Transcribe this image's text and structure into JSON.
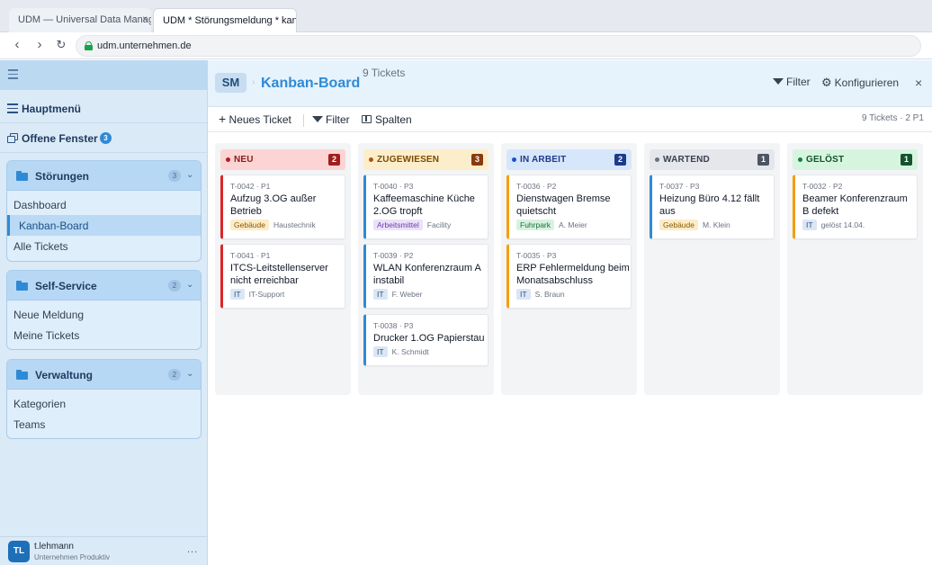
{
  "browser": {
    "tabs": [
      {
        "label": "UDM — Universal Data Manag...",
        "active": false
      },
      {
        "label": "UDM * Störungsmeldung * kanb...",
        "active": true
      }
    ],
    "url": "udm.unternehmen.de"
  },
  "sidebar": {
    "main_menu": "Hauptmenü",
    "open_windows": "Offene Fenster",
    "open_windows_count": "3",
    "groups": [
      {
        "label": "Störungen",
        "count": "3",
        "items": [
          "Dashboard",
          "Kanban-Board",
          "Alle Tickets"
        ],
        "active_item": 1
      },
      {
        "label": "Self-Service",
        "count": "2",
        "items": [
          "Neue Meldung",
          "Meine Tickets"
        ]
      },
      {
        "label": "Verwaltung",
        "count": "2",
        "items": [
          "Kategorien",
          "Teams"
        ]
      }
    ],
    "user": {
      "initials": "TL",
      "name": "t.lehmann",
      "org": "Unternehmen Produktiv",
      "more": "..."
    }
  },
  "header": {
    "module": "SM",
    "title": "Kanban-Board",
    "ticket_count": "9 Tickets",
    "filter": "Filter",
    "configure": "Konfigurieren",
    "close": "×"
  },
  "toolbar": {
    "new_ticket": "Neues Ticket",
    "filter": "Filter",
    "columns": "Spalten",
    "summary": "9 Tickets · 2 P1"
  },
  "colors": {
    "accent": "#2f8ad6",
    "sidebar_bg": "#dbeaf7"
  },
  "columns": [
    {
      "title": "NEU",
      "count": "2",
      "head_bg": "#fcd4d4",
      "title_color": "#8b1a1a",
      "dot": "#b91c1c",
      "badge_bg": "#a11d1d",
      "card_border": "#dc2626",
      "cards": [
        {
          "id": "T-0042 · P1",
          "title": "Aufzug 3.OG außer Betrieb",
          "tag": "Gebäude",
          "tag_bg": "#fdecc8",
          "tag_fg": "#8a5a00",
          "meta": "Haustechnik"
        },
        {
          "id": "T-0041 · P1",
          "title": "ITCS-Leitstellenserver nicht erreichbar",
          "tag": "IT",
          "tag_bg": "#dbe6f5",
          "tag_fg": "#2c4f7c",
          "meta": "IT-Support"
        }
      ]
    },
    {
      "title": "ZUGEWIESEN",
      "count": "3",
      "head_bg": "#fdeecb",
      "title_color": "#7a4a00",
      "dot": "#b45309",
      "badge_bg": "#8a3a10",
      "card_border": "#2f8ad6",
      "cards": [
        {
          "id": "T-0040 · P3",
          "title": "Kaffeemaschine Küche 2.OG tropft",
          "tag": "Arbeitsmittel",
          "tag_bg": "#ece1fb",
          "tag_fg": "#6b3fa0",
          "meta": "Facility"
        },
        {
          "id": "T-0039 · P2",
          "title": "WLAN Konferenzraum A instabil",
          "tag": "IT",
          "tag_bg": "#dbe6f5",
          "tag_fg": "#2c4f7c",
          "meta": "F. Weber"
        },
        {
          "id": "T-0038 · P3",
          "title": "Drucker 1.OG Papierstau",
          "tag": "IT",
          "tag_bg": "#dbe6f5",
          "tag_fg": "#2c4f7c",
          "meta": "K. Schmidt"
        }
      ]
    },
    {
      "title": "IN ARBEIT",
      "count": "2",
      "head_bg": "#d6e6fb",
      "title_color": "#1e3a8a",
      "dot": "#1d4ed8",
      "badge_bg": "#1e3a8a",
      "card_border": "#2f8ad6",
      "cards": [
        {
          "id": "T-0036 · P2",
          "title": "Dienstwagen Bremse quietscht",
          "tag": "Fuhrpark",
          "tag_bg": "#d7f3df",
          "tag_fg": "#1f6b3a",
          "meta": "A. Meier"
        },
        {
          "id": "T-0035 · P3",
          "title": "ERP Fehlermeldung beim Monatsabschluss",
          "tag": "IT",
          "tag_bg": "#dbe6f5",
          "tag_fg": "#2c4f7c",
          "meta": "S. Braun"
        }
      ]
    },
    {
      "title": "WARTEND",
      "count": "1",
      "head_bg": "#e5e7eb",
      "title_color": "#374151",
      "dot": "#6b7280",
      "badge_bg": "#4b5563",
      "card_border": "#2f8ad6",
      "cards": [
        {
          "id": "T-0037 · P3",
          "title": "Heizung Büro 4.12 fällt aus",
          "tag": "Gebäude",
          "tag_bg": "#fdecc8",
          "tag_fg": "#8a5a00",
          "meta": "M. Klein"
        }
      ]
    },
    {
      "title": "GELÖST",
      "count": "1",
      "head_bg": "#d6f5df",
      "title_color": "#14532d",
      "dot": "#15803d",
      "badge_bg": "#14532d",
      "card_border": "#f59e0b",
      "cards": [
        {
          "id": "T-0032 · P2",
          "title": "Beamer Konferenzraum B defekt",
          "tag": "IT",
          "tag_bg": "#dbe6f5",
          "tag_fg": "#2c4f7c",
          "meta": "gelöst 14.04."
        }
      ]
    }
  ]
}
